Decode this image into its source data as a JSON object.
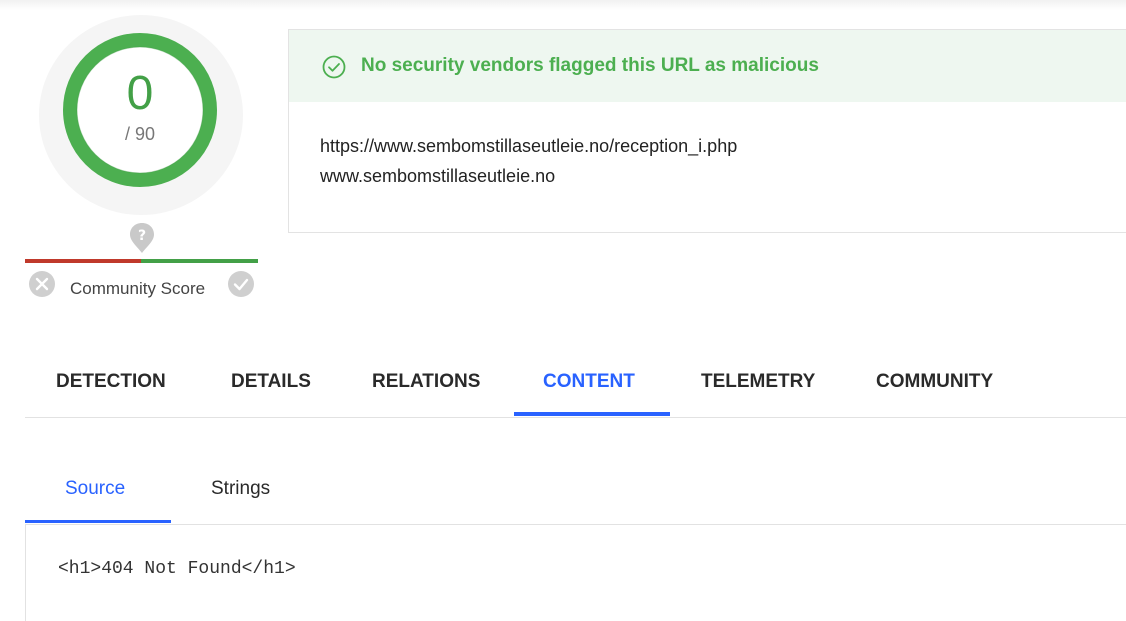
{
  "score": {
    "detections": "0",
    "total": "/ 90",
    "community_label": "Community Score"
  },
  "verdict": {
    "message": "No security vendors flagged this URL as malicious",
    "url": "https://www.sembomstillaseutleie.no/reception_i.php",
    "domain": "www.sembomstillaseutleie.no"
  },
  "main_tabs": [
    {
      "label": "DETECTION"
    },
    {
      "label": "DETAILS"
    },
    {
      "label": "RELATIONS"
    },
    {
      "label": "CONTENT",
      "active": true
    },
    {
      "label": "TELEMETRY"
    },
    {
      "label": "COMMUNITY"
    }
  ],
  "sub_tabs": [
    {
      "label": "Source",
      "active": true
    },
    {
      "label": "Strings"
    }
  ],
  "source": {
    "content": "<h1>404 Not Found</h1>"
  },
  "colors": {
    "clean_green": "#43a047",
    "verdict_green": "#4caf50",
    "verdict_banner_bg": "#eef7f0",
    "accent_blue": "#2962ff",
    "malicious_red": "#c0392b"
  },
  "icons": {
    "verdict": "check-circle-icon",
    "community_unknown": "question-marker-icon",
    "vote_harmful": "close-circle-icon",
    "vote_harmless": "check-circle-filled-icon"
  }
}
